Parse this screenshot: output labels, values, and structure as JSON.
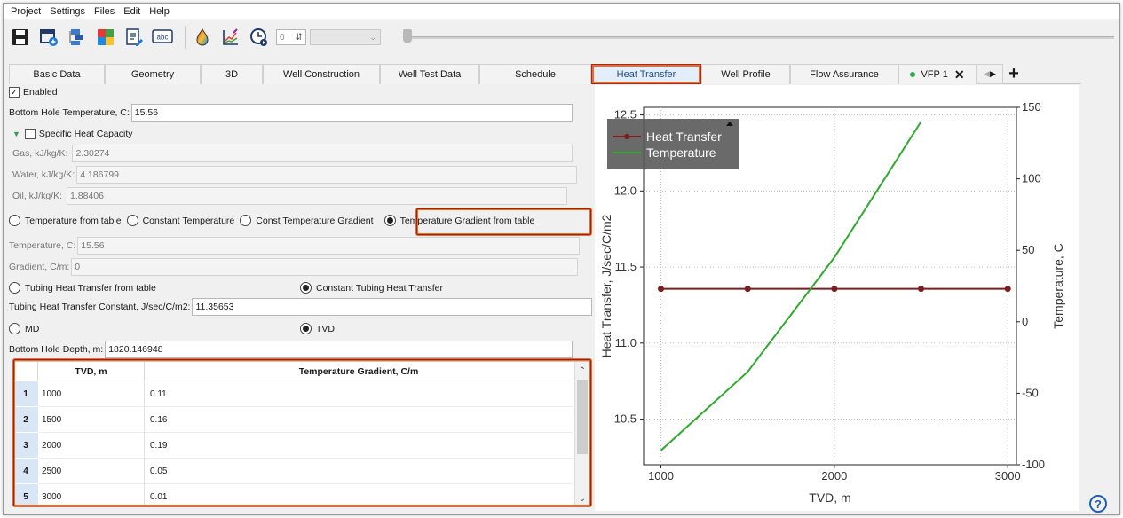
{
  "menu": [
    "Project",
    "Settings",
    "Files",
    "Edit",
    "Help"
  ],
  "toolbar": {
    "icons": [
      "save-icon",
      "new-window-icon",
      "layers-icon",
      "puzzle-icon",
      "edit-doc-icon",
      "spellcheck-icon",
      "drop-icon",
      "chart-edit-icon",
      "clock-play-icon"
    ],
    "spin_value": "0"
  },
  "tabs": [
    {
      "label": "Basic Data",
      "active": false
    },
    {
      "label": "Geometry",
      "active": false
    },
    {
      "label": "3D",
      "active": false
    },
    {
      "label": "Well Construction",
      "active": false
    },
    {
      "label": "Well Test Data",
      "active": false
    },
    {
      "label": "Schedule",
      "active": false
    },
    {
      "label": "Heat Transfer",
      "active": true
    },
    {
      "label": "Well Profile",
      "active": false
    },
    {
      "label": "Flow Assurance",
      "active": false
    },
    {
      "label": "VFP 1",
      "active": false
    }
  ],
  "form": {
    "enabled_label": "Enabled",
    "bht_label": "Bottom Hole Temperature, C:",
    "bht_value": "15.56",
    "shc_label": "Specific Heat Capacity",
    "gas_label": "Gas, kJ/kg/K:",
    "gas_value": "2.30274",
    "water_label": "Water, kJ/kg/K:",
    "water_value": "4.186799",
    "oil_label": "Oil, kJ/kg/K:",
    "oil_value": "1.88406",
    "radio_temp_table": "Temperature from table",
    "radio_const_temp": "Constant Temperature",
    "radio_const_grad": "Const Temperature Gradient",
    "radio_grad_table": "Temperature Gradient from table",
    "temp_label": "Temperature, C:",
    "temp_value": "15.56",
    "grad_label": "Gradient, C/m:",
    "grad_value": "0",
    "radio_tubing_table": "Tubing Heat Transfer from table",
    "radio_tubing_const": "Constant Tubing Heat Transfer",
    "tubing_const_label": "Tubing Heat Transfer Constant, J/sec/C/m2:",
    "tubing_const_value": "11.35653",
    "radio_md": "MD",
    "radio_tvd": "TVD",
    "bhd_label": "Bottom Hole Depth, m:",
    "bhd_value": "1820.146948"
  },
  "table": {
    "headers": [
      "TVD, m",
      "Temperature Gradient, C/m"
    ],
    "rows": [
      [
        "1",
        "1000",
        "0.11"
      ],
      [
        "2",
        "1500",
        "0.16"
      ],
      [
        "3",
        "2000",
        "0.19"
      ],
      [
        "4",
        "2500",
        "0.05"
      ],
      [
        "5",
        "3000",
        "0.01"
      ]
    ]
  },
  "chart_data": {
    "type": "line",
    "xlabel": "TVD, m",
    "ylabel": "Heat Transfer, J/sec/C/m2",
    "y2label": "Temperature, C",
    "xlim": [
      900,
      3050
    ],
    "ylim": [
      10.2,
      12.55
    ],
    "y2lim": [
      -100,
      150
    ],
    "xticks": [
      1000,
      2000,
      3000
    ],
    "yticks": [
      10.5,
      11.0,
      11.5,
      12.0,
      12.5
    ],
    "y2ticks": [
      -100,
      -50,
      0,
      50,
      100,
      150
    ],
    "grid": true,
    "legend_position": "top-left",
    "series": [
      {
        "name": "Heat Transfer",
        "axis": "left",
        "color": "#7a1f1f",
        "marker": true,
        "x": [
          1000,
          1500,
          2000,
          2500,
          3000
        ],
        "y": [
          11.35653,
          11.35653,
          11.35653,
          11.35653,
          11.35653
        ]
      },
      {
        "name": "Temperature",
        "axis": "right",
        "color": "#2eaa2e",
        "marker": false,
        "x": [
          1000,
          1500,
          2000,
          2500
        ],
        "y": [
          -90,
          -35,
          45,
          140
        ]
      }
    ]
  },
  "help_icon": "?"
}
